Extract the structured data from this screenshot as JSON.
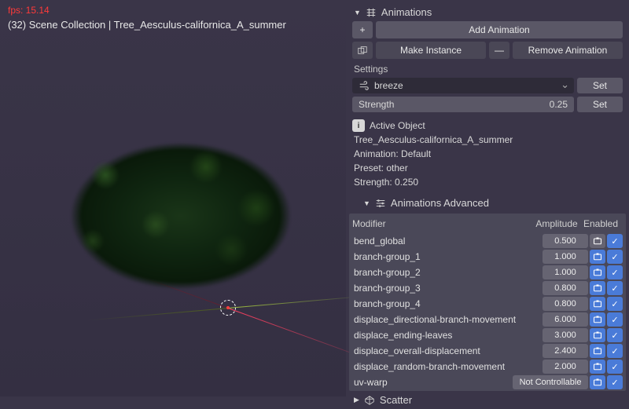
{
  "viewport": {
    "fps_label": "fps: 15.14",
    "scene_label": "(32) Scene Collection | Tree_Aesculus-californica_A_summer"
  },
  "animations": {
    "title": "Animations",
    "add_label": "Add Animation",
    "make_instance_label": "Make Instance",
    "remove_label": "Remove Animation",
    "settings_label": "Settings",
    "preset": "breeze",
    "set_label": "Set",
    "strength_label": "Strength",
    "strength_value": "0.25"
  },
  "active_object": {
    "title": "Active Object",
    "name": "Tree_Aesculus-californica_A_summer",
    "animation_line": "Animation: Default",
    "preset_line": "Preset: other",
    "strength_line": "Strength: 0.250"
  },
  "advanced": {
    "title": "Animations Advanced",
    "col_modifier": "Modifier",
    "col_amplitude": "Amplitude",
    "col_enabled": "Enabled",
    "rows": [
      {
        "name": "bend_global",
        "amplitude": "0.500",
        "enabled": true
      },
      {
        "name": "branch-group_1",
        "amplitude": "1.000",
        "enabled": true
      },
      {
        "name": "branch-group_2",
        "amplitude": "1.000",
        "enabled": true
      },
      {
        "name": "branch-group_3",
        "amplitude": "0.800",
        "enabled": true
      },
      {
        "name": "branch-group_4",
        "amplitude": "0.800",
        "enabled": true
      },
      {
        "name": "displace_directional-branch-movement",
        "amplitude": "6.000",
        "enabled": true
      },
      {
        "name": "displace_ending-leaves",
        "amplitude": "3.000",
        "enabled": true
      },
      {
        "name": "displace_overall-displacement",
        "amplitude": "2.400",
        "enabled": true
      },
      {
        "name": "displace_random-branch-movement",
        "amplitude": "2.000",
        "enabled": true
      },
      {
        "name": "uv-warp",
        "amplitude": "Not Controllable",
        "enabled": true,
        "nc": true
      }
    ]
  },
  "scatter": {
    "title": "Scatter"
  },
  "icons": {
    "plus": "+",
    "minus": "—",
    "check": "✓",
    "info": "i"
  }
}
